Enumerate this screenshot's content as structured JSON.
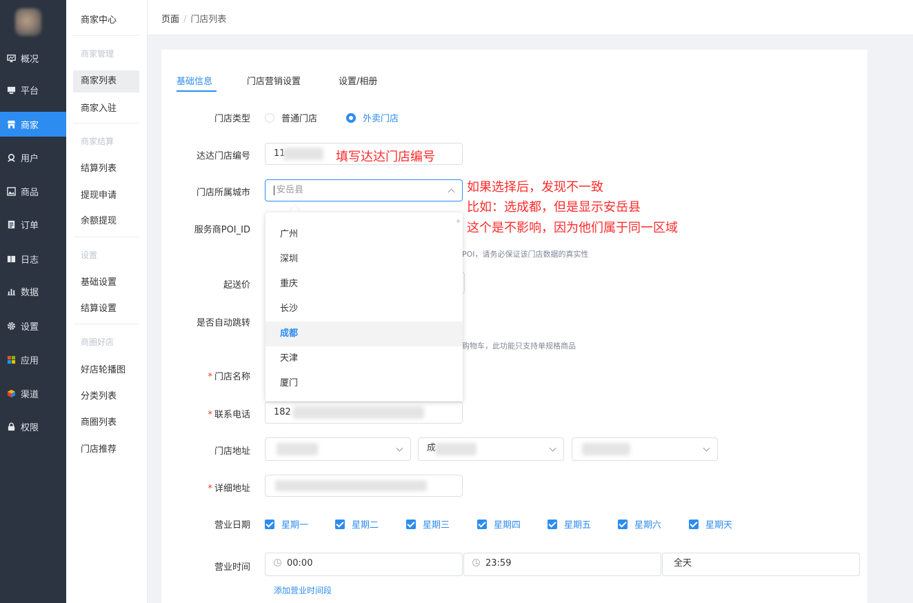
{
  "nav": {
    "items": [
      {
        "label": "概况",
        "icon": "monitor-chart-icon"
      },
      {
        "label": "平台",
        "icon": "desktop-icon"
      },
      {
        "label": "商家",
        "icon": "store-icon",
        "active": true
      },
      {
        "label": "用户",
        "icon": "user-icon"
      },
      {
        "label": "商品",
        "icon": "image-icon"
      },
      {
        "label": "订单",
        "icon": "order-icon"
      },
      {
        "label": "日志",
        "icon": "book-icon"
      },
      {
        "label": "数据",
        "icon": "bar-chart-icon"
      },
      {
        "label": "设置",
        "icon": "gear-icon"
      },
      {
        "label": "应用",
        "icon": "apps-grid-icon"
      },
      {
        "label": "渠道",
        "icon": "cube-icon"
      },
      {
        "label": "权限",
        "icon": "lock-icon"
      }
    ]
  },
  "submenu": {
    "title": "商家中心",
    "groups": [
      {
        "title": "商家管理",
        "items": [
          "商家列表",
          "商家入驻"
        ]
      },
      {
        "title": "商家结算",
        "items": [
          "结算列表",
          "提现申请",
          "余额提现"
        ]
      },
      {
        "title": "设置",
        "items": [
          "基础设置",
          "结算设置"
        ]
      },
      {
        "title": "商圈好店",
        "items": [
          "好店轮播图",
          "分类列表",
          "商圈列表",
          "门店推荐"
        ]
      }
    ]
  },
  "breadcrumb": {
    "root": "页面",
    "separator": "/",
    "current": "门店列表"
  },
  "tabs": [
    "基础信息",
    "门店营销设置",
    "设置/相册"
  ],
  "form": {
    "store_type": {
      "label": "门店类型",
      "options": [
        "普通门店",
        "外卖门店"
      ],
      "selected": "外卖门店"
    },
    "dada_no": {
      "label": "达达门店编号",
      "value_prefix": "11"
    },
    "city": {
      "label": "门店所属城市",
      "placeholder": "安岳县"
    },
    "poi": {
      "label": "服务商POI_ID",
      "hint": "POI，请务必保证该门店数据的真实性"
    },
    "min_price": {
      "label": "起送价"
    },
    "auto_jump": {
      "label": "是否自动跳转",
      "hint": "购物车，此功能只支持单规格商品"
    },
    "store_name": {
      "label": "门店名称",
      "required": true
    },
    "phone": {
      "label": "联系电话",
      "required": true,
      "value_prefix": "182"
    },
    "address": {
      "label": "门店地址",
      "middle_prefix": "成"
    },
    "detail_address": {
      "label": "详细地址",
      "required": true
    },
    "business_days": {
      "label": "营业日期",
      "days": [
        "星期一",
        "星期二",
        "星期三",
        "星期四",
        "星期五",
        "星期六",
        "星期天"
      ]
    },
    "business_time": {
      "label": "营业时间",
      "start": "00:00",
      "end": "23:59",
      "mode": "全天",
      "add_link": "添加营业时间段"
    }
  },
  "city_dropdown": {
    "options": [
      "广州",
      "深圳",
      "重庆",
      "长沙",
      "成都",
      "天津",
      "厦门"
    ],
    "selected": "成都"
  },
  "annotations": {
    "dada": "填写达达门店编号",
    "city_lines": [
      "如果选择后，发现不一致",
      "比如：选成都，但是显示安岳县",
      "这个是不影响，因为他们属于同一区域"
    ]
  },
  "colors": {
    "primary": "#2d8cf0",
    "sidebar_bg": "#2b3440",
    "annotation": "#ff2a2a",
    "required": "#ed4014"
  }
}
